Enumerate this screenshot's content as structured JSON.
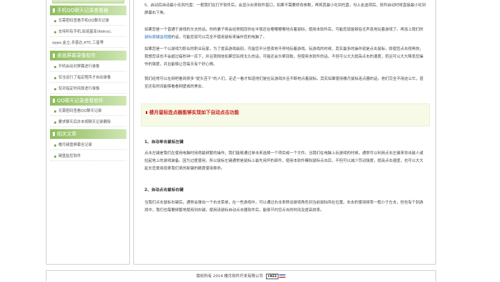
{
  "sidebar": {
    "sections": [
      {
        "title": "手机QQ聊天记录查看器",
        "items": [
          "无需密码查看手机QQ聊天记录",
          "支持所有手机,如诺基亚(Nokia),",
          "oppo,金立,多普达,HTC,三星等"
        ]
      },
      {
        "title": "桌面屏幕录像软件",
        "items": [
          "开机启动对屏幕进行录像",
          "仅当运行了指定程序才自动录像",
          "仅对指定时间段进行录像"
        ]
      },
      {
        "title": "QQ聊天记录查看软件",
        "items": [
          "无需密码查看QQ聊天记录",
          "要求聊天后并未将聊天记录删除"
        ]
      },
      {
        "title": "相关文章",
        "items": [
          "楼月键盘屏幕全记录",
          "键盘监控软件"
        ]
      }
    ]
  },
  "content": {
    "p1": "5、启动后自动最小化到托盘：一般我们在打开软件后，会显示出来软件窗口，如果不需要修改参数，再将其最小化到托盘，勾上此选项后，软件启动时将直接最小化到屏幕右下角。",
    "p2_pre": "如果您是一个普通于游戏的文夫的话，你的妻子将会经常抱怨你在半夜还在嘟嘟嘟嘟地点着鼠标，使用本软件后，可能您就能够俗无声息地玩着游戏了。再加上我们的",
    "p2_link": "鼠标按键监视器",
    "p2_post": "的话，可能您就可以完全不使用鼠标来操作您的电脑了。",
    "p3": "如果您是一个以游戏为职业的职业玩家，为了提高游戏级别，可能您不分昼夜地不停地玩着游戏。玩游戏的时候，其实最多的操作就是点击鼠标。即使您点击得再快，我想您该也不会超过每秒钟一百下，并且我相信如果您玩得太久的话，可能还会头晕目眩，但使用本软件的话，不但可以大大提高点击的速度，而且可以大大降低您操作的强度，并且能够让您每天有个好心情。",
    "p4": "我们经常可以在网吧看到很多“提头苦干”的人们，走近一看才知道他们是在玩游戏并且不断地点着鼠标。其实如果使用楼月鼠标连点器的话，他们完全不用这么忙，甚至还有时间能够看看网壁或的美女。",
    "callout_title": "楼月鼠标连点器能够实现如下自动点击功能",
    "h1": "1、自动单击鼠标左键",
    "p5": "点击左键是我们在使用电脑时用得最频繁的操作，我们能够通过单击来选择一个项目或一个文件。当我们在电脑上玩游戏的时候，通常可以利用点击左键来攻击敌人或捡起地上的游戏装备。因为过度使用，所以鼠标左键通常是鼠标上最先用坏的部件，使用本软件模拟鼠标点击后，不但可以减少劳动强度，提高点击速度，也可以大大延长您爱用现拿我们来的新键的精度使用寿命。",
    "h2": "2、自动点击鼠标右键",
    "p6": "当我们点击鼠标右键后，通常会弹出一个右击菜单，在一些游戏中，可以通过右击来移动游戏角色到当前鼠标所在位置。右击的使用频率一般小于左击，但也有个别游戏中，我们也需要频繁地使用到右键，使用该鼠标自动点击器软件后，能够节约您点击的时间及提高效率。"
  },
  "footer": {
    "text": "版权所有 2014 楼月软件开发有限公司",
    "badge": "CNZZ"
  }
}
